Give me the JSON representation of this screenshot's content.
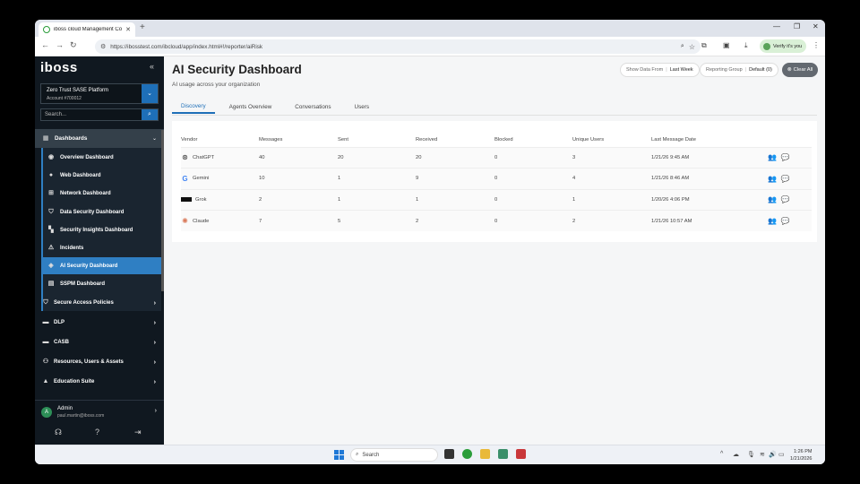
{
  "browser": {
    "tab_title": "iboss cloud Management Cons",
    "url": "https://ibosstest.com/ibcloud/app/index.html#!/reporter/aiRisk",
    "verify_label": "Verify it's you"
  },
  "sidebar": {
    "logo": "iboss",
    "account": {
      "name": "Zero Trust SASE Platform",
      "number": "Account #700012"
    },
    "search_placeholder": "Search...",
    "dashboards_label": "Dashboards",
    "dashboard_items": [
      {
        "label": "Overview Dashboard",
        "icon": "eye-icon"
      },
      {
        "label": "Web Dashboard",
        "icon": "globe-icon"
      },
      {
        "label": "Network Dashboard",
        "icon": "network-icon"
      },
      {
        "label": "Data Security Dashboard",
        "icon": "shield-icon"
      },
      {
        "label": "Security Insights Dashboard",
        "icon": "insights-icon"
      },
      {
        "label": "Incidents",
        "icon": "warning-icon"
      },
      {
        "label": "AI Security Dashboard",
        "icon": "ai-icon",
        "active": true
      },
      {
        "label": "SSPM Dashboard",
        "icon": "sspm-icon"
      }
    ],
    "sections": [
      {
        "label": "Secure Access Policies"
      },
      {
        "label": "DLP"
      },
      {
        "label": "CASB"
      },
      {
        "label": "Resources, Users & Assets"
      },
      {
        "label": "Education Suite"
      }
    ],
    "user": {
      "initial": "A",
      "name": "Admin",
      "email": "paul.martin@iboss.com"
    }
  },
  "main": {
    "title": "AI Security Dashboard",
    "subtitle": "AI usage across your organization",
    "filters": {
      "show_data_from_label": "Show Data From",
      "show_data_from_value": "Last Week",
      "reporting_group_label": "Reporting Group",
      "reporting_group_value": "Default (0)"
    },
    "clear_all": "Clear All",
    "tabs": [
      "Discovery",
      "Agents Overview",
      "Conversations",
      "Users"
    ],
    "table": {
      "headers": [
        "Vendor",
        "Messages",
        "Sent",
        "Received",
        "Blocked",
        "Unique Users",
        "Last Message Date"
      ],
      "rows": [
        {
          "vendor": "ChatGPT",
          "messages": "40",
          "sent": "20",
          "received": "20",
          "blocked": "0",
          "unique_users": "3",
          "last_date": "1/21/26 9:45 AM"
        },
        {
          "vendor": "Gemini",
          "messages": "10",
          "sent": "1",
          "received": "9",
          "blocked": "0",
          "unique_users": "4",
          "last_date": "1/21/26 8:46 AM"
        },
        {
          "vendor": "Grok",
          "messages": "2",
          "sent": "1",
          "received": "1",
          "blocked": "0",
          "unique_users": "1",
          "last_date": "1/20/26 4:06 PM"
        },
        {
          "vendor": "Claude",
          "messages": "7",
          "sent": "5",
          "received": "2",
          "blocked": "0",
          "unique_users": "2",
          "last_date": "1/21/26 10:57 AM"
        }
      ]
    }
  },
  "taskbar": {
    "search_placeholder": "Search",
    "time": "1:26 PM",
    "date": "1/21/2026"
  }
}
